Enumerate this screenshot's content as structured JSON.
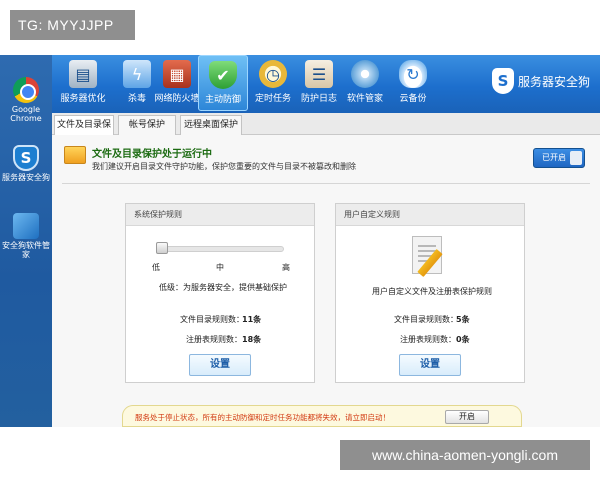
{
  "watermarks": {
    "top": "TG: MYYJJPP",
    "bottom": "www.china-aomen-yongli.com"
  },
  "desktop": {
    "icons": [
      {
        "label": "Google Chrome",
        "icon": "chrome-icon"
      },
      {
        "label": "服务器安全狗",
        "icon": "safedog-shield-icon"
      },
      {
        "label": "安全狗软件管家",
        "icon": "software-manager-icon"
      }
    ]
  },
  "toolbar": {
    "items": [
      {
        "label": "服务器优化",
        "icon": "server-icon"
      },
      {
        "label": "杀毒",
        "icon": "antivirus-icon"
      },
      {
        "label": "网络防火墙",
        "icon": "firewall-icon"
      },
      {
        "label": "主动防御",
        "icon": "active-defense-shield-icon"
      },
      {
        "label": "定时任务",
        "icon": "clock-icon"
      },
      {
        "label": "防护日志",
        "icon": "clipboard-log-icon"
      },
      {
        "label": "软件管家",
        "icon": "software-disc-icon"
      },
      {
        "label": "云备份",
        "icon": "cloud-backup-icon"
      }
    ],
    "active_index": 3,
    "brand": "服务器安全狗"
  },
  "tabs": [
    "文件及目录保护",
    "帐号保护",
    "远程桌面保护"
  ],
  "status": {
    "title": "文件及目录保护处于运行中",
    "subtitle": "我们建议开启目录文件守护功能，保护您重要的文件与目录不被篡改和删除",
    "toggle_label": "已开启"
  },
  "system_panel": {
    "header": "系统保护规则",
    "levels": {
      "low": "低",
      "mid": "中",
      "high": "高"
    },
    "level_value": 0,
    "level_desc": "低级：为服务器安全，提供基础保护",
    "file_rules_label": "文件目录规则数：",
    "file_rules_value": "11条",
    "reg_rules_label": "注册表规则数：",
    "reg_rules_value": "18条",
    "button": "设置"
  },
  "custom_panel": {
    "header": "用户自定义规则",
    "desc": "用户自定义文件及注册表保护规则",
    "file_rules_label": "文件目录规则数：",
    "file_rules_value": "5条",
    "reg_rules_label": "注册表规则数：",
    "reg_rules_value": "0条",
    "button": "设置"
  },
  "warning": {
    "text": "服务处于停止状态，所有的主动防御和定时任务功能都将失效，请立即启动！",
    "button": "开启"
  }
}
